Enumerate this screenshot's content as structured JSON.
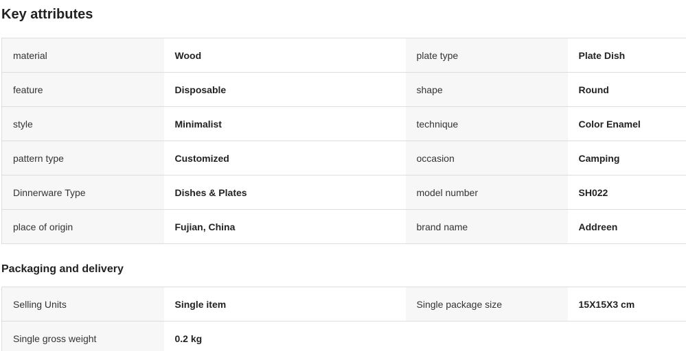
{
  "key_attributes": {
    "title": "Key attributes",
    "rows": [
      [
        {
          "k": "material",
          "v": "Wood"
        },
        {
          "k": "plate type",
          "v": "Plate Dish"
        }
      ],
      [
        {
          "k": "feature",
          "v": "Disposable"
        },
        {
          "k": "shape",
          "v": "Round"
        }
      ],
      [
        {
          "k": "style",
          "v": "Minimalist"
        },
        {
          "k": "technique",
          "v": "Color Enamel"
        }
      ],
      [
        {
          "k": "pattern type",
          "v": "Customized"
        },
        {
          "k": "occasion",
          "v": "Camping"
        }
      ],
      [
        {
          "k": "Dinnerware Type",
          "v": "Dishes & Plates"
        },
        {
          "k": "model number",
          "v": "SH022"
        }
      ],
      [
        {
          "k": "place of origin",
          "v": "Fujian, China"
        },
        {
          "k": "brand name",
          "v": "Addreen"
        }
      ]
    ]
  },
  "packaging": {
    "title": "Packaging and delivery",
    "rows": [
      [
        {
          "k": "Selling Units",
          "v": "Single item"
        },
        {
          "k": "Single package size",
          "v": "15X15X3 cm"
        }
      ],
      [
        {
          "k": "Single gross weight",
          "v": "0.2 kg"
        }
      ]
    ]
  }
}
